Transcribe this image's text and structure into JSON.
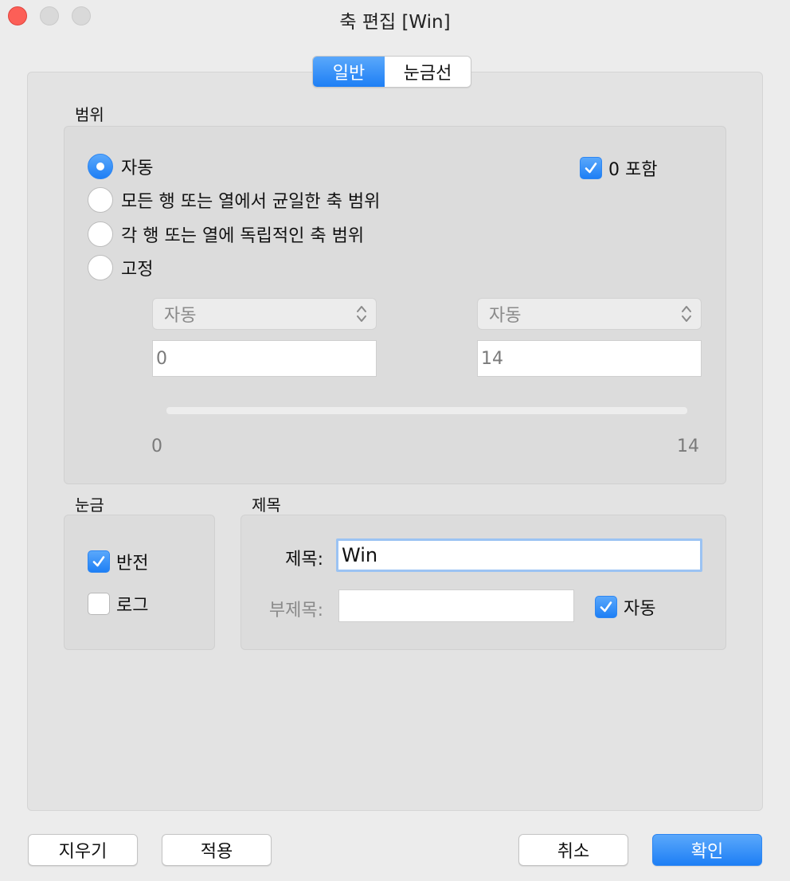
{
  "window": {
    "title": "축 편집 [Win]"
  },
  "tabs": [
    {
      "label": "일반",
      "active": true
    },
    {
      "label": "눈금선",
      "active": false
    }
  ],
  "range": {
    "section_label": "범위",
    "options": [
      {
        "label": "자동",
        "selected": true
      },
      {
        "label": "모든 행 또는 열에서 균일한 축 범위",
        "selected": false
      },
      {
        "label": "각 행 또는 열에 독립적인 축 범위",
        "selected": false
      },
      {
        "label": "고정",
        "selected": false
      }
    ],
    "include_zero": {
      "label": "0 포함",
      "checked": true
    },
    "start_popup": "자동",
    "end_popup": "자동",
    "start_value": "0",
    "end_value": "14",
    "slider_min_label": "0",
    "slider_max_label": "14"
  },
  "tick_marks": {
    "section_label": "눈금",
    "reversed": {
      "label": "반전",
      "checked": true
    },
    "logarithmic": {
      "label": "로그",
      "checked": false
    }
  },
  "axis_title": {
    "section_label": "제목",
    "title_label": "제목:",
    "title_value": "Win",
    "subtitle_label": "부제목:",
    "subtitle_value": "",
    "auto": {
      "label": "자동",
      "checked": true
    }
  },
  "buttons": {
    "clear": "지우기",
    "apply": "적용",
    "cancel": "취소",
    "ok": "확인"
  },
  "colors": {
    "accent": "#1e7ff5",
    "close": "#fc5f57"
  }
}
